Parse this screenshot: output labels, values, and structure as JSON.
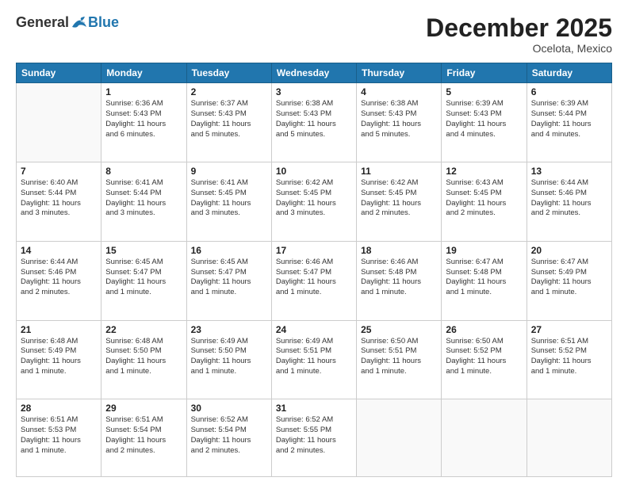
{
  "header": {
    "logo_general": "General",
    "logo_blue": "Blue",
    "title": "December 2025",
    "location": "Ocelota, Mexico"
  },
  "days_of_week": [
    "Sunday",
    "Monday",
    "Tuesday",
    "Wednesday",
    "Thursday",
    "Friday",
    "Saturday"
  ],
  "weeks": [
    [
      {
        "day": "",
        "info": ""
      },
      {
        "day": "1",
        "info": "Sunrise: 6:36 AM\nSunset: 5:43 PM\nDaylight: 11 hours\nand 6 minutes."
      },
      {
        "day": "2",
        "info": "Sunrise: 6:37 AM\nSunset: 5:43 PM\nDaylight: 11 hours\nand 5 minutes."
      },
      {
        "day": "3",
        "info": "Sunrise: 6:38 AM\nSunset: 5:43 PM\nDaylight: 11 hours\nand 5 minutes."
      },
      {
        "day": "4",
        "info": "Sunrise: 6:38 AM\nSunset: 5:43 PM\nDaylight: 11 hours\nand 5 minutes."
      },
      {
        "day": "5",
        "info": "Sunrise: 6:39 AM\nSunset: 5:43 PM\nDaylight: 11 hours\nand 4 minutes."
      },
      {
        "day": "6",
        "info": "Sunrise: 6:39 AM\nSunset: 5:44 PM\nDaylight: 11 hours\nand 4 minutes."
      }
    ],
    [
      {
        "day": "7",
        "info": "Sunrise: 6:40 AM\nSunset: 5:44 PM\nDaylight: 11 hours\nand 3 minutes."
      },
      {
        "day": "8",
        "info": "Sunrise: 6:41 AM\nSunset: 5:44 PM\nDaylight: 11 hours\nand 3 minutes."
      },
      {
        "day": "9",
        "info": "Sunrise: 6:41 AM\nSunset: 5:45 PM\nDaylight: 11 hours\nand 3 minutes."
      },
      {
        "day": "10",
        "info": "Sunrise: 6:42 AM\nSunset: 5:45 PM\nDaylight: 11 hours\nand 3 minutes."
      },
      {
        "day": "11",
        "info": "Sunrise: 6:42 AM\nSunset: 5:45 PM\nDaylight: 11 hours\nand 2 minutes."
      },
      {
        "day": "12",
        "info": "Sunrise: 6:43 AM\nSunset: 5:45 PM\nDaylight: 11 hours\nand 2 minutes."
      },
      {
        "day": "13",
        "info": "Sunrise: 6:44 AM\nSunset: 5:46 PM\nDaylight: 11 hours\nand 2 minutes."
      }
    ],
    [
      {
        "day": "14",
        "info": "Sunrise: 6:44 AM\nSunset: 5:46 PM\nDaylight: 11 hours\nand 2 minutes."
      },
      {
        "day": "15",
        "info": "Sunrise: 6:45 AM\nSunset: 5:47 PM\nDaylight: 11 hours\nand 1 minute."
      },
      {
        "day": "16",
        "info": "Sunrise: 6:45 AM\nSunset: 5:47 PM\nDaylight: 11 hours\nand 1 minute."
      },
      {
        "day": "17",
        "info": "Sunrise: 6:46 AM\nSunset: 5:47 PM\nDaylight: 11 hours\nand 1 minute."
      },
      {
        "day": "18",
        "info": "Sunrise: 6:46 AM\nSunset: 5:48 PM\nDaylight: 11 hours\nand 1 minute."
      },
      {
        "day": "19",
        "info": "Sunrise: 6:47 AM\nSunset: 5:48 PM\nDaylight: 11 hours\nand 1 minute."
      },
      {
        "day": "20",
        "info": "Sunrise: 6:47 AM\nSunset: 5:49 PM\nDaylight: 11 hours\nand 1 minute."
      }
    ],
    [
      {
        "day": "21",
        "info": "Sunrise: 6:48 AM\nSunset: 5:49 PM\nDaylight: 11 hours\nand 1 minute."
      },
      {
        "day": "22",
        "info": "Sunrise: 6:48 AM\nSunset: 5:50 PM\nDaylight: 11 hours\nand 1 minute."
      },
      {
        "day": "23",
        "info": "Sunrise: 6:49 AM\nSunset: 5:50 PM\nDaylight: 11 hours\nand 1 minute."
      },
      {
        "day": "24",
        "info": "Sunrise: 6:49 AM\nSunset: 5:51 PM\nDaylight: 11 hours\nand 1 minute."
      },
      {
        "day": "25",
        "info": "Sunrise: 6:50 AM\nSunset: 5:51 PM\nDaylight: 11 hours\nand 1 minute."
      },
      {
        "day": "26",
        "info": "Sunrise: 6:50 AM\nSunset: 5:52 PM\nDaylight: 11 hours\nand 1 minute."
      },
      {
        "day": "27",
        "info": "Sunrise: 6:51 AM\nSunset: 5:52 PM\nDaylight: 11 hours\nand 1 minute."
      }
    ],
    [
      {
        "day": "28",
        "info": "Sunrise: 6:51 AM\nSunset: 5:53 PM\nDaylight: 11 hours\nand 1 minute."
      },
      {
        "day": "29",
        "info": "Sunrise: 6:51 AM\nSunset: 5:54 PM\nDaylight: 11 hours\nand 2 minutes."
      },
      {
        "day": "30",
        "info": "Sunrise: 6:52 AM\nSunset: 5:54 PM\nDaylight: 11 hours\nand 2 minutes."
      },
      {
        "day": "31",
        "info": "Sunrise: 6:52 AM\nSunset: 5:55 PM\nDaylight: 11 hours\nand 2 minutes."
      },
      {
        "day": "",
        "info": ""
      },
      {
        "day": "",
        "info": ""
      },
      {
        "day": "",
        "info": ""
      }
    ]
  ]
}
